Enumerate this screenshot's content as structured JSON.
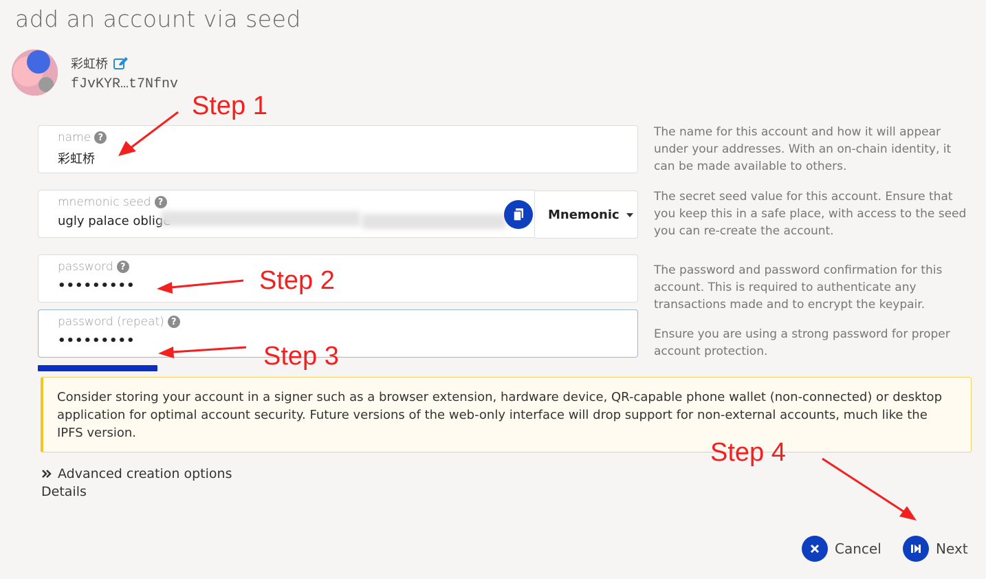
{
  "page": {
    "title": "add an account via seed"
  },
  "account": {
    "name": "彩虹桥",
    "address": "fJvKYR…t7Nfnv"
  },
  "fields": {
    "name": {
      "label": "name",
      "value": "彩虹桥"
    },
    "seed": {
      "label": "mnemonic seed",
      "value_visible": "ugly palace oblige '",
      "type_selected": "Mnemonic"
    },
    "password": {
      "label": "password",
      "value": "•••••••••"
    },
    "password_repeat": {
      "label": "password (repeat)",
      "value": "•••••••••"
    }
  },
  "help": {
    "name": "The name for this account and how it will appear under your addresses. With an on-chain identity, it can be made available to others.",
    "seed": "The secret seed value for this account. Ensure that you keep this in a safe place, with access to the seed you can re-create the account.",
    "password": "The password and password confirmation for this account. This is required to authenticate any transactions made and to encrypt the keypair.",
    "password_strength": "Ensure you are using a strong password for proper account protection."
  },
  "warning": "Consider storing your account in a signer such as a browser extension, hardware device, QR-capable phone wallet (non-connected) or desktop application for optimal account security. Future versions of the web-only interface will drop support for non-external accounts, much like the IPFS version.",
  "advanced": {
    "label": "Advanced creation options",
    "details": "Details"
  },
  "buttons": {
    "cancel": "Cancel",
    "next": "Next"
  },
  "annotations": {
    "step1": "Step 1",
    "step2": "Step 2",
    "step3": "Step 3",
    "step4": "Step 4"
  },
  "colors": {
    "accent": "#0e3fbe",
    "annotation": "#f2201e",
    "warning_border": "#f3c623"
  },
  "icons": [
    "edit-icon",
    "help-icon",
    "copy-icon",
    "caret-down-icon",
    "double-chevron-right-icon",
    "close-icon",
    "skip-next-icon"
  ]
}
